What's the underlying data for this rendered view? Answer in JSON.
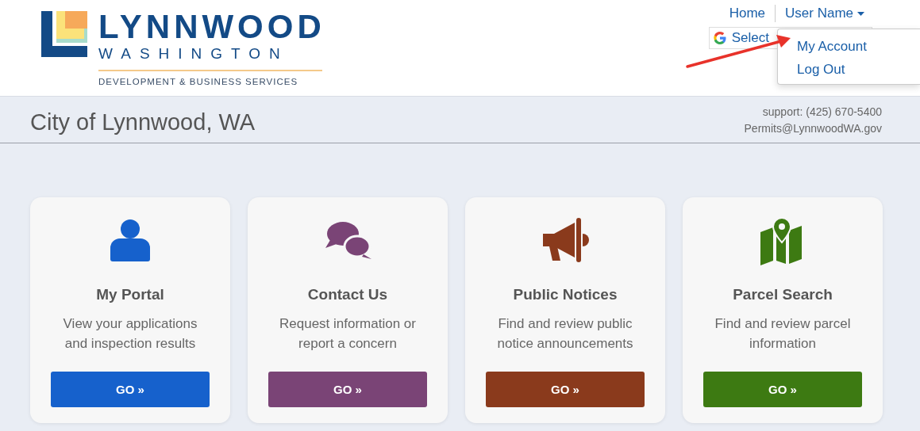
{
  "logo": {
    "name": "LYNNWOOD",
    "state": "WASHINGTON",
    "tagline": "DEVELOPMENT & BUSINESS SERVICES"
  },
  "nav": {
    "links": [
      {
        "label": "Home"
      },
      {
        "label": "User Name",
        "expanded": true
      }
    ]
  },
  "translate": {
    "label": "Select"
  },
  "user_menu": {
    "items": [
      {
        "label": "My Account"
      },
      {
        "label": "Log Out"
      }
    ]
  },
  "annotation": {
    "kind": "arrow",
    "color": "#e8322a"
  },
  "banner": {
    "title": "City of Lynnwood, WA",
    "support": "support: (425) 670-5400",
    "email": "Permits@LynnwoodWA.gov"
  },
  "cards": [
    {
      "kind": "person",
      "title": "My Portal",
      "description": "View your applications and inspection results",
      "button": "GO »",
      "color": "#1661cc"
    },
    {
      "kind": "chat",
      "title": "Contact Us",
      "description": "Request information or report a concern",
      "button": "GO »",
      "color": "#7a4476"
    },
    {
      "kind": "megaphone",
      "title": "Public Notices",
      "description": "Find and review public notice announcements",
      "button": "GO »",
      "color": "#8a3a1c"
    },
    {
      "kind": "map",
      "title": "Parcel Search",
      "description": "Find and review parcel information",
      "button": "GO »",
      "color": "#3d7a12"
    }
  ]
}
